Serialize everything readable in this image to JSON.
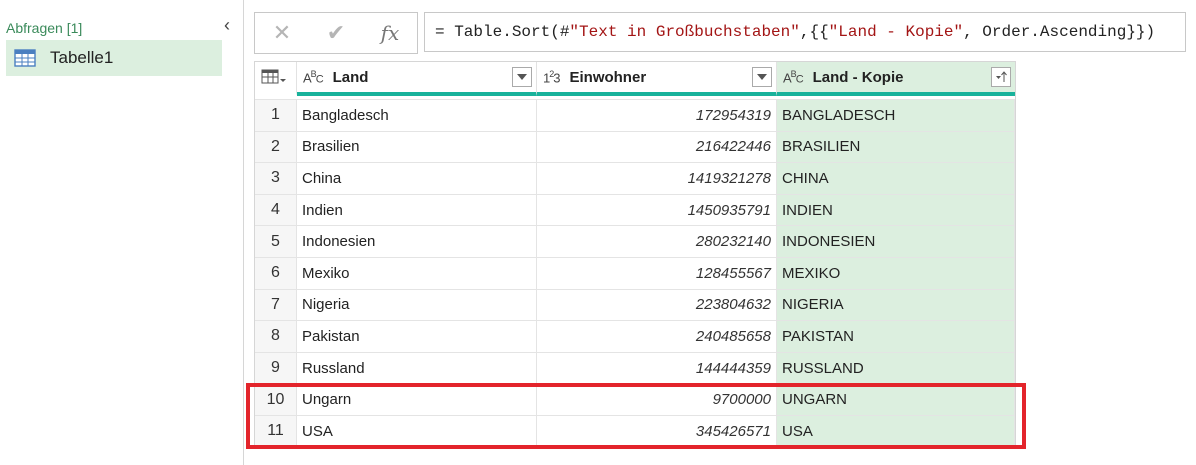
{
  "queries": {
    "header": "Abfragen [1]",
    "items": [
      {
        "label": "Tabelle1"
      }
    ]
  },
  "formula": {
    "prefix": "= Table.Sort(#",
    "str1": "\"Text in Großbuchstaben\"",
    "mid": ",{{",
    "str2": "\"Land - Kopie\"",
    "suffix": ", Order.Ascending}})"
  },
  "columns": [
    {
      "name": "Land",
      "type": "text"
    },
    {
      "name": "Einwohner",
      "type": "number"
    },
    {
      "name": "Land - Kopie",
      "type": "text",
      "sorted": "ascending"
    }
  ],
  "rows": [
    {
      "idx": "1",
      "land": "Bangladesch",
      "pop": "172954319",
      "copy": "BANGLADESCH"
    },
    {
      "idx": "2",
      "land": "Brasilien",
      "pop": "216422446",
      "copy": "BRASILIEN"
    },
    {
      "idx": "3",
      "land": "China",
      "pop": "1419321278",
      "copy": "CHINA"
    },
    {
      "idx": "4",
      "land": "Indien",
      "pop": "1450935791",
      "copy": "INDIEN"
    },
    {
      "idx": "5",
      "land": "Indonesien",
      "pop": "280232140",
      "copy": "INDONESIEN"
    },
    {
      "idx": "6",
      "land": "Mexiko",
      "pop": "128455567",
      "copy": "MEXIKO"
    },
    {
      "idx": "7",
      "land": "Nigeria",
      "pop": "223804632",
      "copy": "NIGERIA"
    },
    {
      "idx": "8",
      "land": "Pakistan",
      "pop": "240485658",
      "copy": "PAKISTAN"
    },
    {
      "idx": "9",
      "land": "Russland",
      "pop": "144444359",
      "copy": "RUSSLAND"
    },
    {
      "idx": "10",
      "land": "Ungarn",
      "pop": "9700000",
      "copy": "UNGARN"
    },
    {
      "idx": "11",
      "land": "USA",
      "pop": "345426571",
      "copy": "USA"
    }
  ],
  "colors": {
    "accent": "#18b29b",
    "selected_bg": "#dcefdf",
    "highlight": "#e3242b"
  },
  "icons": {
    "cancel": "close-icon",
    "confirm": "check-icon",
    "fx": "fx-icon"
  }
}
